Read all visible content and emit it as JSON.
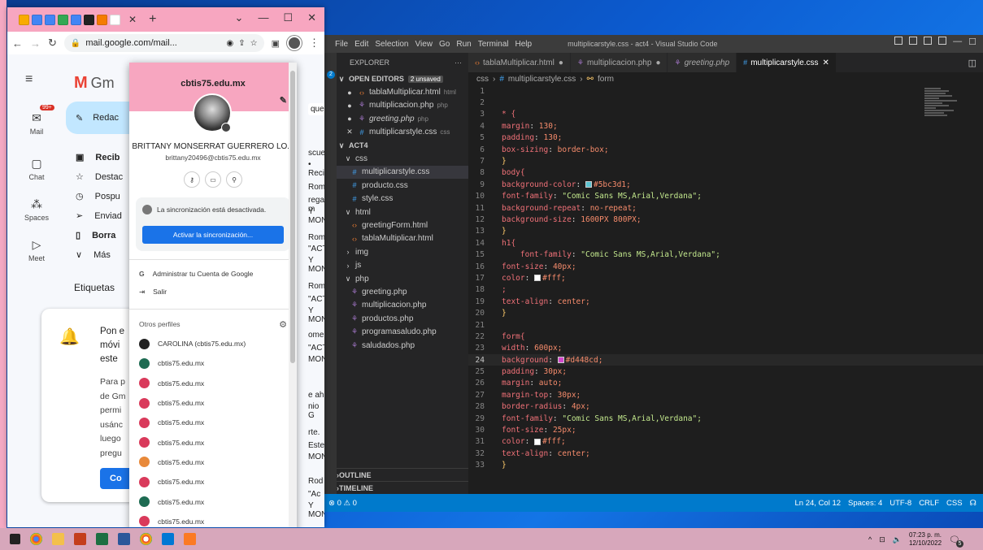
{
  "chrome": {
    "url": "mail.google.com/mail...",
    "gmail_logo": "Gm",
    "rail": [
      {
        "label": "Mail",
        "badge": "99+",
        "icon": "mail-icon"
      },
      {
        "label": "Chat",
        "icon": "chat-icon"
      },
      {
        "label": "Spaces",
        "icon": "spaces-icon"
      },
      {
        "label": "Meet",
        "icon": "meet-icon"
      }
    ],
    "compose": "Redac",
    "nav": [
      "Recib",
      "Destac",
      "Pospu",
      "Enviad",
      "Borra",
      "Más"
    ],
    "labels": "Etiquetas",
    "card": {
      "title1": "Pon e",
      "title2": "móvi",
      "title3": "este",
      "body1": "Para p",
      "body2": "de Gm",
      "body3": "permi",
      "body4": "usánc",
      "body5": "luego",
      "body6": "pregu",
      "btn": "Co"
    },
    "mail_col": [
      "queda",
      "scuen",
      "• Reci",
      "Rome",
      "rega m",
      "Y MON",
      "Rome",
      "\"ACTI",
      "Y MON",
      "Rome",
      "\"ACTI",
      "Y MON",
      "ome",
      "\"ACTI",
      "MON",
      "e ah",
      "nio G",
      "rte.",
      "Este",
      "MON",
      "Rod",
      "\"Ac",
      "Y MON"
    ]
  },
  "popup": {
    "domain": "cbtis75.edu.mx",
    "name": "BRITTANY MONSERRAT GUERRERO LO...",
    "email": "brittany20496@cbtis75.edu.mx",
    "sync_text": "La sincronización está desactivada.",
    "sync_button": "Activar la sincronización...",
    "manage": "Administrar tu Cuenta de Google",
    "logout": "Salir",
    "other_profiles": "Otros perfiles",
    "profiles": [
      {
        "label": "CAROLINA (cbtis75.edu.mx)",
        "color": "#222222"
      },
      {
        "label": "cbtis75.edu.mx",
        "color": "#1e6b52"
      },
      {
        "label": "cbtis75.edu.mx",
        "color": "#d93a5b"
      },
      {
        "label": "cbtis75.edu.mx",
        "color": "#d93a5b"
      },
      {
        "label": "cbtis75.edu.mx",
        "color": "#d93a5b"
      },
      {
        "label": "cbtis75.edu.mx",
        "color": "#d93a5b"
      },
      {
        "label": "cbtis75.edu.mx",
        "color": "#e8893a"
      },
      {
        "label": "cbtis75.edu.mx",
        "color": "#d93a5b"
      },
      {
        "label": "cbtis75.edu.mx",
        "color": "#1e6b52"
      },
      {
        "label": "cbtis75.edu.mx",
        "color": "#d93a5b"
      }
    ]
  },
  "vscode": {
    "menu": [
      "File",
      "Edit",
      "Selection",
      "View",
      "Go",
      "Run",
      "Terminal",
      "Help"
    ],
    "window_title": "multiplicarstyle.css - act4 - Visual Studio Code",
    "explorer_title": "EXPLORER",
    "open_editors": "OPEN EDITORS",
    "unsaved_badge": "2 unsaved",
    "open_files": [
      {
        "name": "tablaMultiplicar.html",
        "hint": "html",
        "type": "html"
      },
      {
        "name": "multiplicacion.php",
        "hint": "php",
        "type": "php"
      },
      {
        "name": "greeting.php",
        "hint": "php",
        "type": "php"
      },
      {
        "name": "multiplicarstyle.css",
        "hint": "css",
        "type": "css"
      }
    ],
    "project": "ACT4",
    "tree": [
      {
        "name": "css",
        "kind": "folder",
        "indent": 1
      },
      {
        "name": "multiplicarstyle.css",
        "kind": "css",
        "indent": 2
      },
      {
        "name": "producto.css",
        "kind": "css",
        "indent": 2
      },
      {
        "name": "style.css",
        "kind": "css",
        "indent": 2
      },
      {
        "name": "html",
        "kind": "folder",
        "indent": 1
      },
      {
        "name": "greetingForm.html",
        "kind": "html",
        "indent": 2
      },
      {
        "name": "tablaMultiplicar.html",
        "kind": "html",
        "indent": 2
      },
      {
        "name": "img",
        "kind": "folder-closed",
        "indent": 1
      },
      {
        "name": "js",
        "kind": "folder-closed",
        "indent": 1
      },
      {
        "name": "php",
        "kind": "folder",
        "indent": 1
      },
      {
        "name": "greeting.php",
        "kind": "php",
        "indent": 2
      },
      {
        "name": "multiplicacion.php",
        "kind": "php",
        "indent": 2
      },
      {
        "name": "productos.php",
        "kind": "php",
        "indent": 2
      },
      {
        "name": "programasaludo.php",
        "kind": "php",
        "indent": 2
      },
      {
        "name": "saludados.php",
        "kind": "php",
        "indent": 2
      }
    ],
    "outline": "OUTLINE",
    "timeline": "TIMELINE",
    "tabs": [
      {
        "name": "tablaMultiplicar.html",
        "type": "html",
        "mark": "●"
      },
      {
        "name": "multiplicacion.php",
        "type": "php",
        "mark": "●"
      },
      {
        "name": "greeting.php",
        "type": "php",
        "mark": ""
      },
      {
        "name": "multiplicarstyle.css",
        "type": "css",
        "mark": "✕"
      }
    ],
    "breadcrumb": [
      "css",
      "multiplicarstyle.css",
      "form"
    ],
    "code": [
      "",
      "",
      "* {",
      "margin: 130;",
      "padding: 130;",
      "box-sizing: border-box;",
      "}",
      "body{",
      "background-color: #5bc3d1;",
      "font-family: \"Comic Sans MS,Arial,Verdana\";",
      "background-repeat: no-repeat;",
      "background-size: 1600PX 800PX;",
      "}",
      "h1{",
      "    font-family: \"Comic Sans MS,Arial,Verdana\";",
      "font-size: 40px;",
      "color: #fff;",
      ";",
      "text-align: center;",
      "}",
      "",
      "form{",
      "width: 600px;",
      "background: #d448cd;",
      "padding: 30px;",
      "margin: auto;",
      "margin-top: 30px;",
      "border-radius: 4px;",
      "font-family: \"Comic Sans MS,Arial,Verdana\";",
      "font-size: 25px;",
      "color: #fff;",
      "text-align: center;",
      "}"
    ],
    "current_line": 24,
    "status": {
      "left": "⊗ 0 ⚠ 0",
      "position": "Ln 24, Col 12",
      "spaces": "Spaces: 4",
      "encoding": "UTF-8",
      "eol": "CRLF",
      "lang": "CSS"
    },
    "swatches": {
      "cyan": "#5bc3d1",
      "white": "#ffffff",
      "magenta": "#d448cd"
    }
  },
  "taskbar": {
    "time": "07:23 p. m.",
    "date": "12/10/2022",
    "notif": "5"
  }
}
